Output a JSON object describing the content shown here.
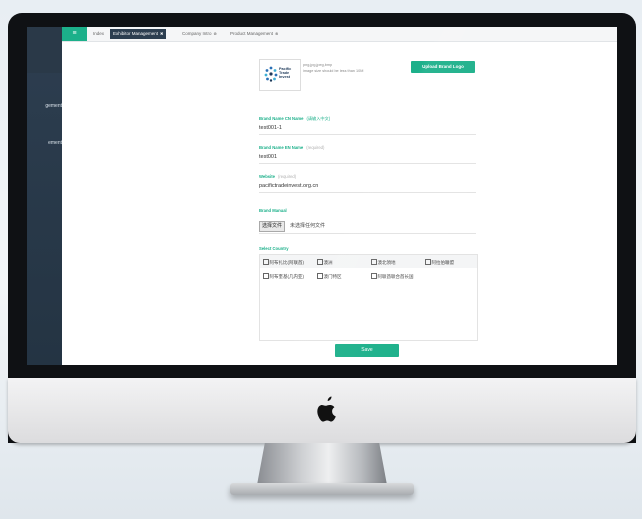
{
  "topbar": {
    "menu_icon": "hamburger-icon",
    "tabs": [
      {
        "label": "Index",
        "active": false,
        "closable": false
      },
      {
        "label": "Exhibitor Management",
        "active": true,
        "closable": true
      },
      {
        "label": "Company Intro",
        "active": false,
        "closable": true
      },
      {
        "label": "Product Management",
        "active": false,
        "closable": true
      }
    ]
  },
  "sidebar": {
    "items": [
      {
        "label": "gement"
      },
      {
        "label": "ement"
      }
    ]
  },
  "logo_upload": {
    "thumb_text": [
      "Pacific",
      "Trade",
      "Invest"
    ],
    "hint_line1": "png,jpg,jpeg,bmp",
    "hint_line2": "image size should be less than 10M",
    "button_label": "Upload Brand Logo"
  },
  "form": {
    "brand_name_cn": {
      "label": "Brand Name CN Name",
      "hint": "(请输入中文)",
      "value": "test001-1"
    },
    "brand_name_en": {
      "label": "Brand Name EN Name",
      "hint": "(required)",
      "value": "test001"
    },
    "website": {
      "label": "Website",
      "hint": "(required)",
      "value": "pacifictradeinvest.org.cn"
    },
    "brand_manual": {
      "label": "Brand Manual",
      "file_button": "选择文件",
      "file_status": "未选择任何文件"
    },
    "select_country": {
      "label": "Select Country",
      "options": [
        {
          "label": "阿布扎比(阿联酋)",
          "checked": false
        },
        {
          "label": "澳洲",
          "checked": false
        },
        {
          "label": "澳北領地",
          "checked": false
        },
        {
          "label": "阿拉伯聯盟",
          "checked": false
        },
        {
          "label": "阿布奎基(几内亚)",
          "checked": false
        },
        {
          "label": "澳门特区",
          "checked": false
        },
        {
          "label": "阿联酋联合酋长国",
          "checked": false
        }
      ]
    },
    "save_label": "Save"
  },
  "colors": {
    "accent": "#1cb08a",
    "sidebar": "#2d3e50",
    "active_tab": "#2c3e50"
  }
}
